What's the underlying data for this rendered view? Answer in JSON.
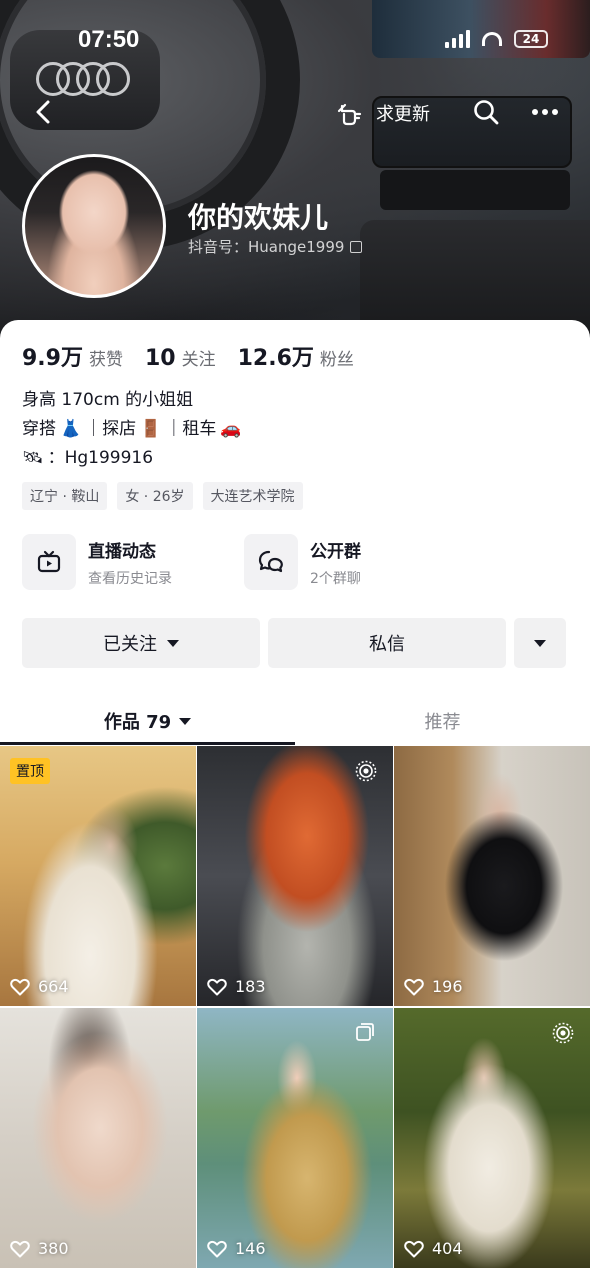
{
  "status_bar": {
    "time": "07:50",
    "battery": "24"
  },
  "header": {
    "tap_update_label": "求更新",
    "nickname": "你的欢妹儿",
    "douyin_id": "抖音号：Huange1999"
  },
  "stats": [
    {
      "num": "9.9万",
      "label": "获赞"
    },
    {
      "num": "10",
      "label": "关注"
    },
    {
      "num": "12.6万",
      "label": "粉丝"
    }
  ],
  "bio": {
    "line1": "身高 170cm 的小姐姐",
    "line2_a": "穿搭",
    "line2_b": "｜探店",
    "line2_c": "｜租车",
    "line3": "：Hg199916"
  },
  "tags": [
    "辽宁 · 鞍山",
    "女 · 26岁",
    "大连艺术学院"
  ],
  "features": [
    {
      "title": "直播动态",
      "subtitle": "查看历史记录",
      "icon": "tv-icon"
    },
    {
      "title": "公开群",
      "subtitle": "2个群聊",
      "icon": "chat-bubbles-icon"
    }
  ],
  "actions": {
    "follow_label": "已关注",
    "message_label": "私信"
  },
  "tabs": {
    "works_label": "作品 79",
    "recommend_label": "推荐"
  },
  "posts": [
    {
      "likes": "664",
      "pinned": "置顶"
    },
    {
      "likes": "183"
    },
    {
      "likes": "196"
    },
    {
      "likes": "380"
    },
    {
      "likes": "146"
    },
    {
      "likes": "404"
    }
  ]
}
